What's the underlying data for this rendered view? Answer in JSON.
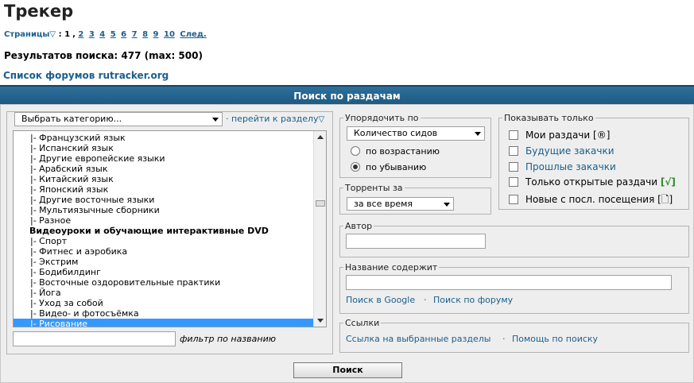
{
  "page": {
    "title": "Трекер",
    "pages_label": "Страницы",
    "pages_current": "1",
    "pages_links": [
      "2",
      "3",
      "4",
      "5",
      "6",
      "7",
      "8",
      "9",
      "10"
    ],
    "pages_next": "След.",
    "results": "Результатов поиска: 477 (max: 500)",
    "forum_link": "Список форумов rutracker.org"
  },
  "header": {
    "title": "Поиск по раздачам"
  },
  "categories": {
    "select_label": "Выбрать категорию...",
    "goto_label": "· перейти к разделу",
    "items": [
      "|- Французский язык",
      "|- Испанский язык",
      "|- Другие европейские языки",
      "|- Арабский язык",
      "|- Китайский язык",
      "|- Японский язык",
      "|- Другие восточные языки",
      "|- Мультиязычные сборники",
      "|- Разное",
      "Видеоуроки и обучающие интерактивные DVD",
      "|- Спорт",
      "|- Фитнес и аэробика",
      "|- Экстрим",
      "|- Бодибилдинг",
      "|- Восточные оздоровительные практики",
      "|- Йога",
      "|- Уход за собой",
      "|- Видео- и фотосъёмка",
      "|- Рисование"
    ],
    "filter_label": "фильтр по названию"
  },
  "sort": {
    "legend": "Упорядочить по",
    "selected": "Количество сидов",
    "asc_label": "по возрастанию",
    "desc_label": "по убыванию",
    "selected_order": "desc"
  },
  "period": {
    "legend": "Торренты за",
    "selected": "за все время"
  },
  "show_only": {
    "legend": "Показывать только",
    "items": [
      {
        "label": "Мои раздачи",
        "suffix": "[®]"
      },
      {
        "label": "Будущие закачки",
        "suffix": ""
      },
      {
        "label": "Прошлые закачки",
        "suffix": ""
      },
      {
        "label": "Только открытые раздачи",
        "suffix": "[√]"
      },
      {
        "label": "Новые с посл. посещения",
        "suffix": "[🗋]"
      }
    ]
  },
  "author": {
    "legend": "Автор"
  },
  "title_search": {
    "legend": "Название содержит",
    "google_link": "Поиск в Google",
    "forum_link": "Поиск по форуму"
  },
  "links": {
    "legend": "Ссылки",
    "selected_link": "Ссылка на выбранные разделы",
    "help_link": "Помощь по поиску"
  },
  "search_button": "Поиск",
  "colors": {
    "header_bg": "#1d5a84",
    "link": "#1a5f8d",
    "selection": "#3399ff",
    "panel_bg": "#eeeeee"
  }
}
